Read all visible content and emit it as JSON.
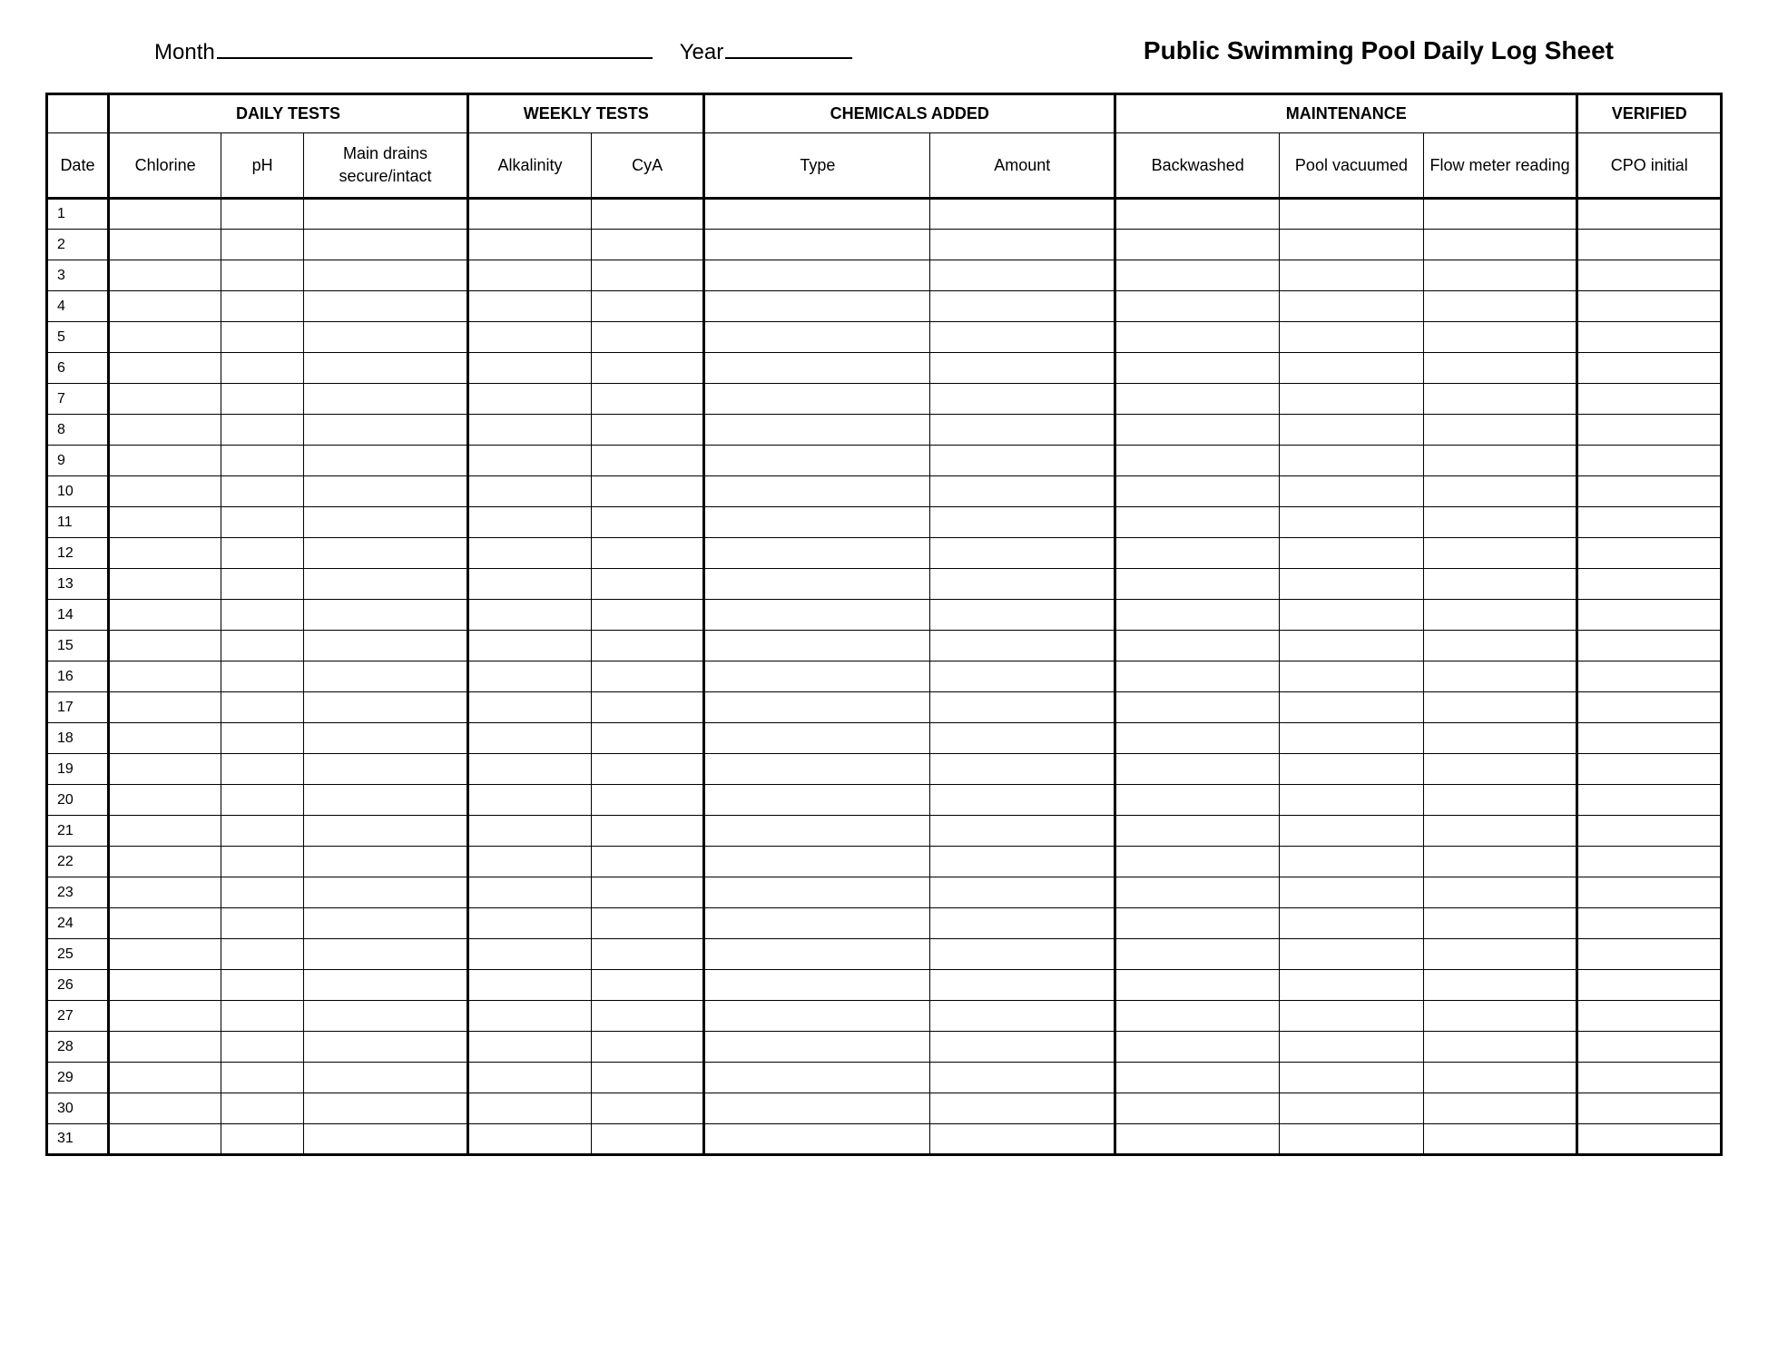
{
  "header": {
    "month_label": "Month",
    "year_label": "Year",
    "title": "Public Swimming Pool Daily Log Sheet"
  },
  "table": {
    "groups": {
      "blank": "",
      "daily": "DAILY TESTS",
      "weekly": "WEEKLY TESTS",
      "chemicals": "CHEMICALS ADDED",
      "maintenance": "MAINTENANCE",
      "verified": "VERIFIED"
    },
    "columns": {
      "date": "Date",
      "chlorine": "Chlorine",
      "ph": "pH",
      "drains": "Main drains secure/intact",
      "alkalinity": "Alkalinity",
      "cya": "CyA",
      "type": "Type",
      "amount": "Amount",
      "backwashed": "Backwashed",
      "vacuumed": "Pool vacuumed",
      "flow": "Flow meter reading",
      "cpo": "CPO initial"
    },
    "rows": [
      {
        "date": "1"
      },
      {
        "date": "2"
      },
      {
        "date": "3"
      },
      {
        "date": "4"
      },
      {
        "date": "5"
      },
      {
        "date": "6"
      },
      {
        "date": "7"
      },
      {
        "date": "8"
      },
      {
        "date": "9"
      },
      {
        "date": "10"
      },
      {
        "date": "11"
      },
      {
        "date": "12"
      },
      {
        "date": "13"
      },
      {
        "date": "14"
      },
      {
        "date": "15"
      },
      {
        "date": "16"
      },
      {
        "date": "17"
      },
      {
        "date": "18"
      },
      {
        "date": "19"
      },
      {
        "date": "20"
      },
      {
        "date": "21"
      },
      {
        "date": "22"
      },
      {
        "date": "23"
      },
      {
        "date": "24"
      },
      {
        "date": "25"
      },
      {
        "date": "26"
      },
      {
        "date": "27"
      },
      {
        "date": "28"
      },
      {
        "date": "29"
      },
      {
        "date": "30"
      },
      {
        "date": "31"
      }
    ]
  }
}
